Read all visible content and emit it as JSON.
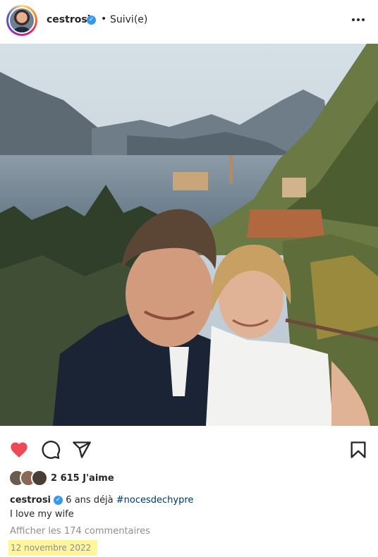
{
  "header": {
    "username": "cestrosi",
    "separator": "•",
    "follow_status": "Suivi(e)",
    "more_icon": "more-horizontal-icon",
    "verified_icon": "verified-badge-icon"
  },
  "actions": {
    "like_icon": "heart-filled-icon",
    "comment_icon": "comment-icon",
    "share_icon": "share-icon",
    "save_icon": "bookmark-icon",
    "like_color": "#ed4956"
  },
  "likes": {
    "count_text": "2 615 J'aime"
  },
  "caption": {
    "username": "cestrosi",
    "text": "6 ans déjà",
    "hashtag": "#nocesdechypre",
    "line2": "I love my wife"
  },
  "comments": {
    "link_text": "Afficher les 174 commentaires"
  },
  "post_date": "12 novembre 2022",
  "colors": {
    "highlight": "#fff59a",
    "link": "#00376b",
    "muted": "#8e8e8e",
    "verified": "#3897f0"
  }
}
